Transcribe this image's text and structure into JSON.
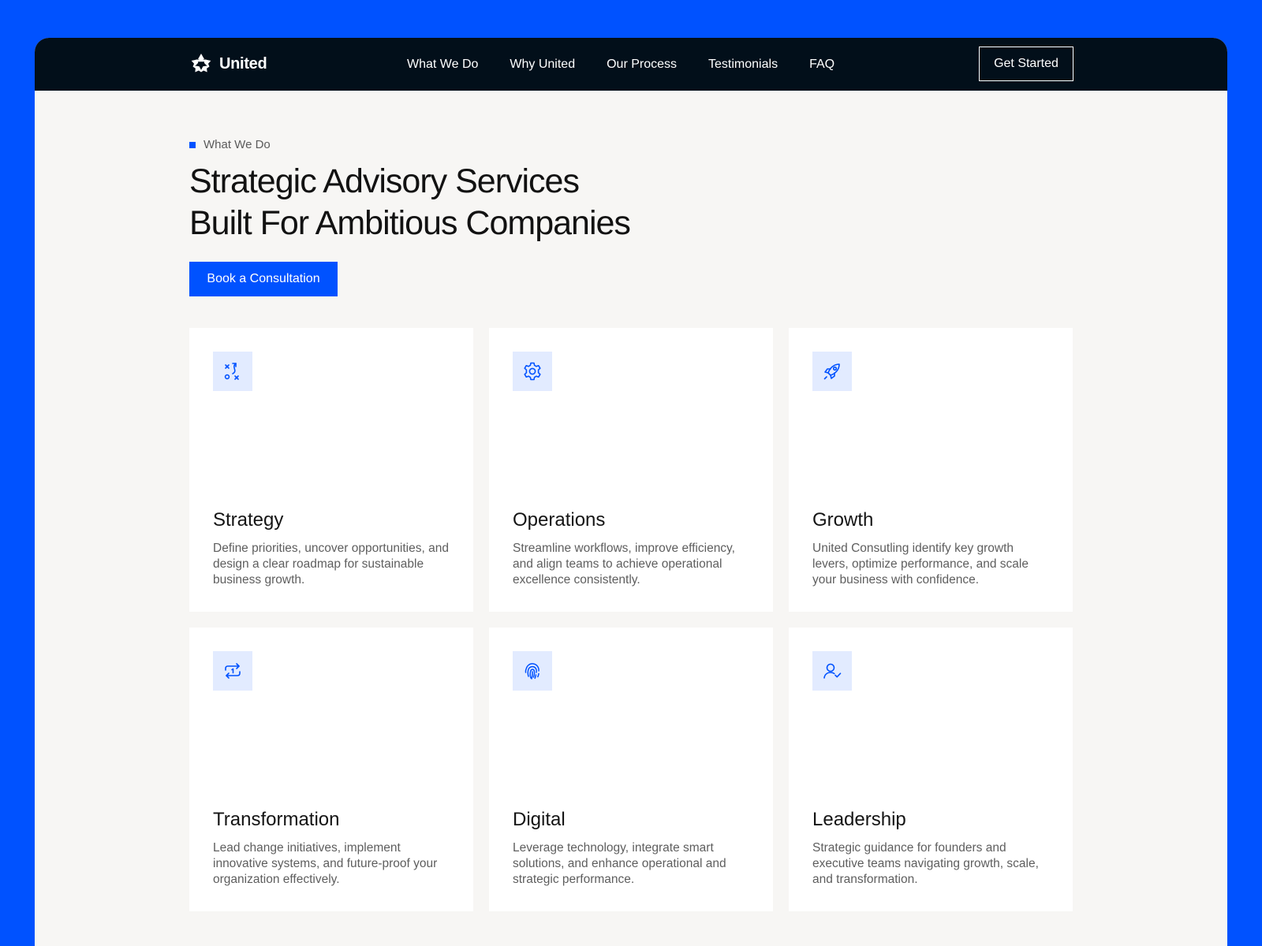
{
  "header": {
    "brand": "United",
    "nav": [
      "What We Do",
      "Why United",
      "Our Process",
      "Testimonials",
      "FAQ"
    ],
    "cta_label": "Get Started"
  },
  "hero": {
    "eyebrow": "What We Do",
    "title_line1": "Strategic Advisory Services",
    "title_line2": "Built For Ambitious Companies",
    "button_label": "Book a Consultation"
  },
  "services": [
    {
      "icon": "strategy-play-icon",
      "title": "Strategy",
      "desc": "Define priorities, uncover opportunities, and design a clear roadmap for sustainable business growth."
    },
    {
      "icon": "gear-icon",
      "title": "Operations",
      "desc": "Streamline workflows, improve efficiency, and align teams to achieve operational excellence consistently."
    },
    {
      "icon": "rocket-icon",
      "title": "Growth",
      "desc": "United Consutling identify key growth levers, optimize performance, and scale your business with confidence."
    },
    {
      "icon": "repeat-one-icon",
      "title": "Transformation",
      "desc": "Lead change initiatives, implement innovative systems, and future-proof your organization effectively."
    },
    {
      "icon": "fingerprint-icon",
      "title": "Digital",
      "desc": "Leverage technology, integrate smart solutions, and enhance operational and strategic performance."
    },
    {
      "icon": "user-check-icon",
      "title": "Leadership",
      "desc": "Strategic guidance for founders and executive teams navigating growth, scale, and transformation."
    }
  ],
  "colors": {
    "accent": "#0052ff",
    "navbar": "#020f1a",
    "page_bg": "#f7f6f4",
    "icon_tile": "#e2ebff"
  }
}
